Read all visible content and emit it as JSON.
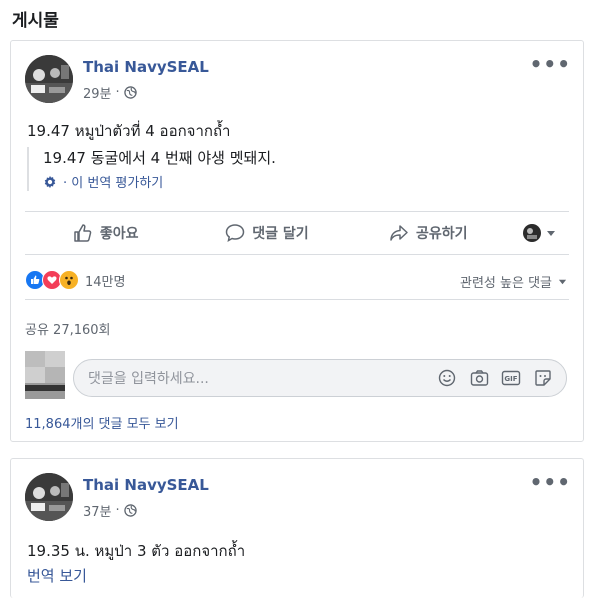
{
  "section": {
    "title": "게시물"
  },
  "post1": {
    "page_name": "Thai NavySEAL",
    "time": "29분",
    "dot": "·",
    "text": "19.47 หมูป่าตัวที่ 4 ออกจากถ้ำ",
    "translation": "19.47 동굴에서 4 번째 야생 멧돼지.",
    "rate_translation": "· 이 번역 평가하기",
    "actions": {
      "like": "좋아요",
      "comment": "댓글 달기",
      "share": "공유하기"
    },
    "reactions_count": "14만명",
    "relevance": "관련성 높은 댓글",
    "shares": "공유 27,160회",
    "comment_placeholder": "댓글을 입력하세요...",
    "view_all_comments": "11,864개의 댓글 모두 보기",
    "gif_label": "GIF"
  },
  "post2": {
    "page_name": "Thai NavySEAL",
    "time": "37분",
    "dot": "·",
    "text": "19.35 น. หมูป่า 3 ตัว ออกจากถ้ำ",
    "see_translation": "번역 보기"
  },
  "colors": {
    "link": "#385898",
    "like_blue": "#1877f2",
    "love_red": "#f33e58",
    "wow_yellow": "#f7b125"
  }
}
